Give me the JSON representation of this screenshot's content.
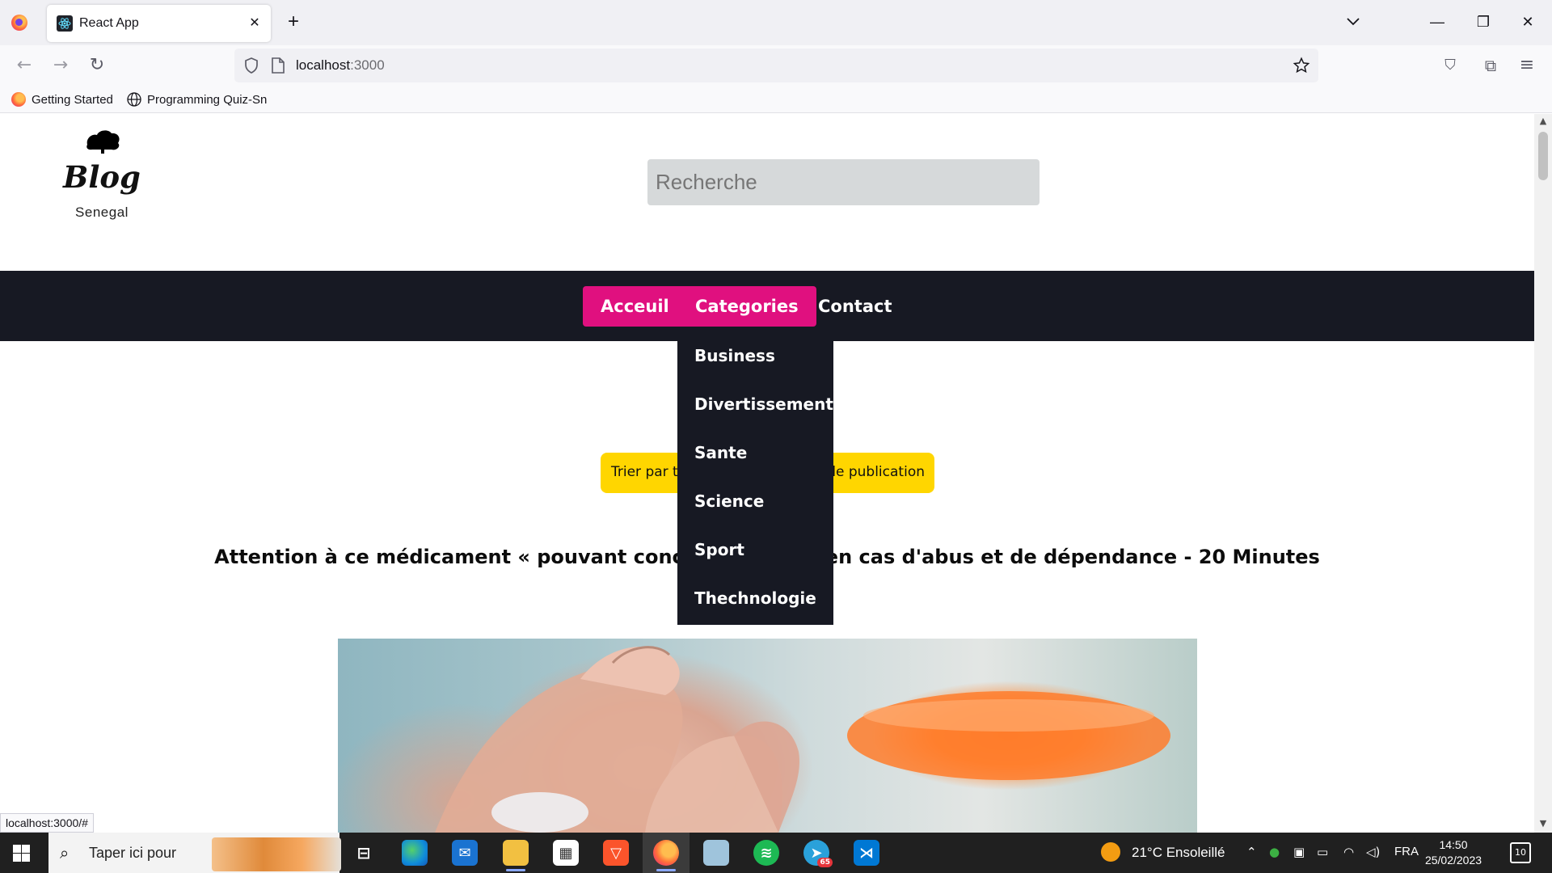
{
  "browser": {
    "tab_title": "React App",
    "url_host": "localhost",
    "url_port": ":3000",
    "bookmarks": [
      "Getting Started",
      "Programming Quiz-Sn"
    ],
    "status_url": "localhost:3000/#"
  },
  "site": {
    "logo_title": "Blog",
    "logo_subtitle": "Senegal",
    "search_placeholder": "Recherche",
    "nav": {
      "home": "Acceuil",
      "categories": "Categories",
      "contact": "Contact"
    },
    "categories_menu": [
      "Business",
      "Divertissement",
      "Sante",
      "Science",
      "Sport",
      "Thechnologie"
    ],
    "sort_button": {
      "left_visible": "Trier par ti",
      "right_visible": "de publication"
    },
    "article_title_left": "Attention à ce médicament « pouvant conc",
    "article_title_right": "en cas d'abus et de dépendance - 20 Minutes",
    "colors": {
      "nav_bg": "#171923",
      "accent": "#e0107f",
      "sort_button": "#ffd600",
      "search_bg": "#d6d9da"
    }
  },
  "taskbar": {
    "search_text": "Taper ici pour",
    "weather": "21°C  Ensoleillé",
    "language": "FRA",
    "time": "14:50",
    "date": "25/02/2023",
    "notification_count": "10",
    "telegram_badge": "65",
    "apps": [
      "task-view-icon",
      "edge-icon",
      "mail-icon",
      "file-explorer-icon",
      "store-icon",
      "brave-icon",
      "firefox-icon",
      "notes-icon",
      "spotify-icon",
      "telegram-icon",
      "vscode-icon"
    ]
  }
}
